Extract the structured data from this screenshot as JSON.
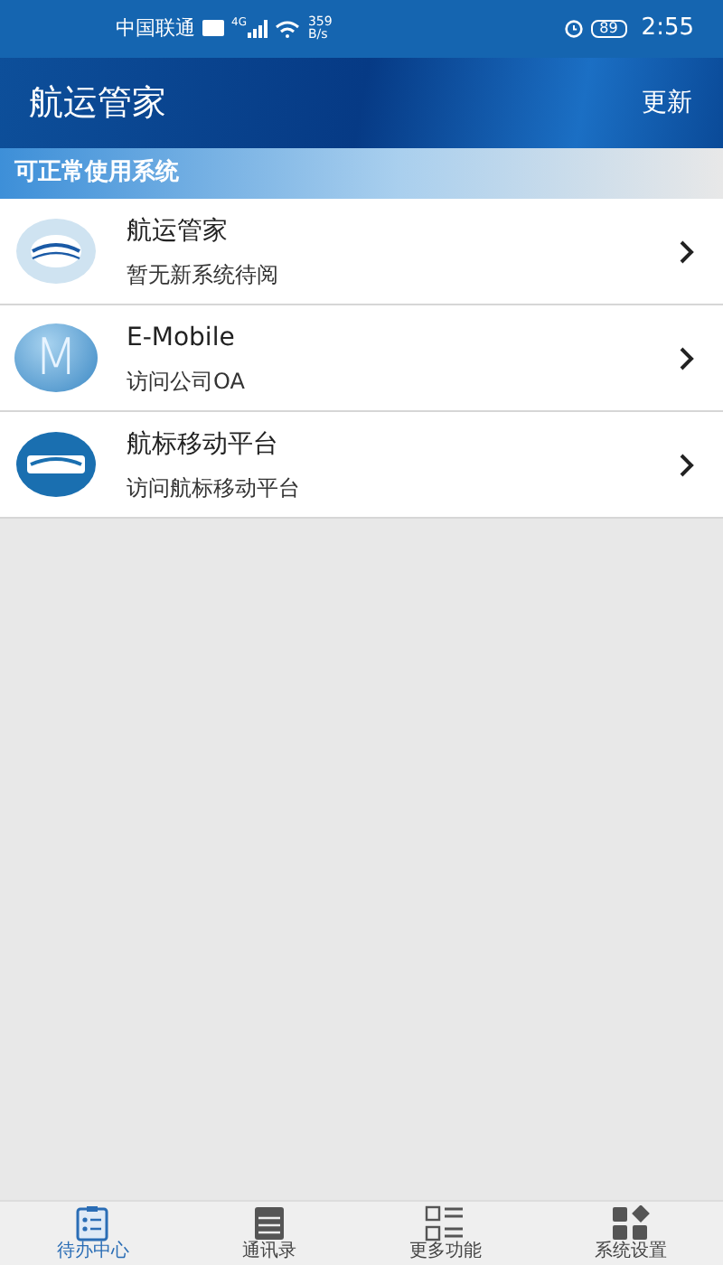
{
  "status_bar": {
    "carrier": "中国联通",
    "network": "4G",
    "speed_value": "359",
    "speed_unit": "B/s",
    "battery": "89",
    "time": "2:55"
  },
  "header": {
    "title": "航运管家",
    "action": "更新"
  },
  "section": {
    "title": "可正常使用系统"
  },
  "systems": [
    {
      "kind": "cosco-light",
      "title": "航运管家",
      "subtitle": "暂无新系统待阅"
    },
    {
      "kind": "letter",
      "letter": "M",
      "title": "E-Mobile",
      "subtitle": "访问公司OA"
    },
    {
      "kind": "cosco-dark",
      "title": "航标移动平台",
      "subtitle": "访问航标移动平台"
    }
  ],
  "tabs": [
    {
      "kind": "clipboard",
      "label": "待办中心",
      "selected": true
    },
    {
      "kind": "book",
      "label": "通讯录",
      "selected": false
    },
    {
      "kind": "list",
      "label": "更多功能",
      "selected": false
    },
    {
      "kind": "blocks",
      "label": "系统设置",
      "selected": false
    }
  ]
}
